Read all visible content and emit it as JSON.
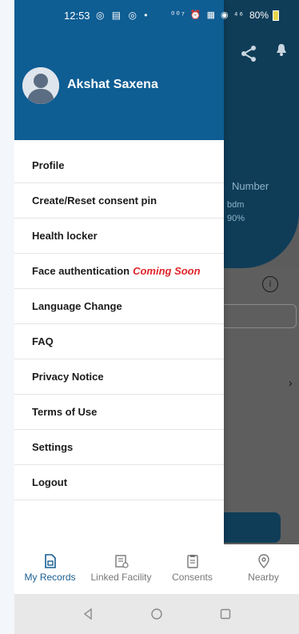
{
  "status_bar": {
    "time": "12:53",
    "left_icons": "◎ ▤ ◎ •",
    "right_icons": "⁰⁰⁷ ⏰ ▦ ◉ ⁴⁶",
    "battery": "80%"
  },
  "background": {
    "card_line1": "Number",
    "card_line2": "bdm",
    "card_line3": "90%"
  },
  "drawer": {
    "user_name": "Akshat Saxena",
    "menu": [
      {
        "label": "Profile"
      },
      {
        "label": "Create/Reset consent pin"
      },
      {
        "label": "Health locker"
      },
      {
        "label": "Face authentication",
        "badge": "Coming Soon"
      },
      {
        "label": "Language Change"
      },
      {
        "label": "FAQ"
      },
      {
        "label": "Privacy Notice"
      },
      {
        "label": "Terms of Use"
      },
      {
        "label": "Settings"
      },
      {
        "label": "Logout"
      }
    ]
  },
  "bottom_nav": {
    "items": [
      {
        "label": "My Records",
        "icon": "records-icon",
        "active": true
      },
      {
        "label": "Linked Facility",
        "icon": "facility-icon",
        "active": false
      },
      {
        "label": "Consents",
        "icon": "consents-icon",
        "active": false
      },
      {
        "label": "Nearby",
        "icon": "location-icon",
        "active": false
      }
    ]
  },
  "colors": {
    "drawer_header": "#0e5d93",
    "accent": "#1a5e93",
    "coming_soon": "#e0262b"
  }
}
